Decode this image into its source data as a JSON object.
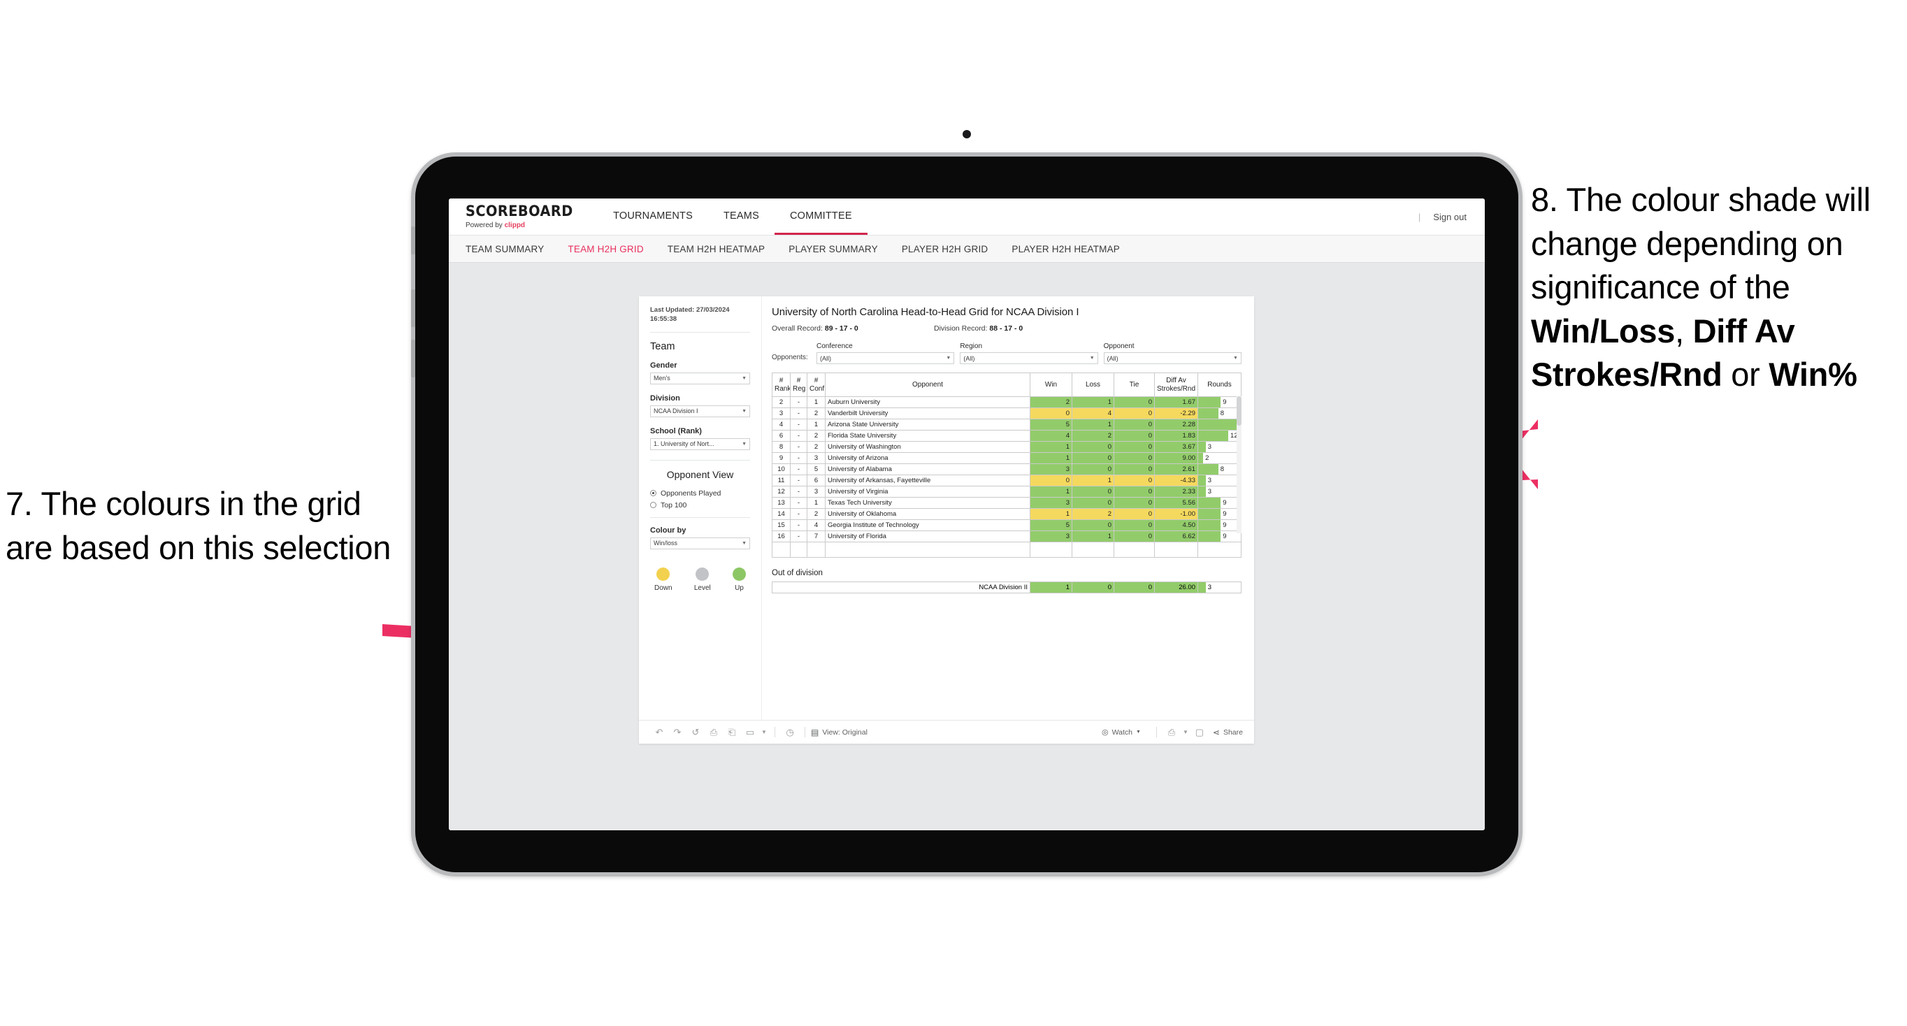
{
  "annotations": {
    "left": {
      "number": "7.",
      "text": "The colours in the grid are based on this selection"
    },
    "right": {
      "number": "8.",
      "line1": "The colour shade will change depending on significance of the ",
      "bold1": "Win/Loss",
      "mid1": ", ",
      "bold2": "Diff Av Strokes/Rnd",
      "mid2": " or ",
      "bold3": "Win%"
    },
    "arrow_color": "#ec2f63"
  },
  "app": {
    "brand": {
      "title": "SCOREBOARD",
      "powered_prefix": "Powered by ",
      "powered_name": "clippd"
    },
    "top_nav": [
      {
        "label": "TOURNAMENTS",
        "active": false
      },
      {
        "label": "TEAMS",
        "active": false
      },
      {
        "label": "COMMITTEE",
        "active": true
      }
    ],
    "sign_out": "Sign out",
    "sub_nav": [
      {
        "label": "TEAM SUMMARY",
        "active": false
      },
      {
        "label": "TEAM H2H GRID",
        "active": true
      },
      {
        "label": "TEAM H2H HEATMAP",
        "active": false
      },
      {
        "label": "PLAYER SUMMARY",
        "active": false
      },
      {
        "label": "PLAYER H2H GRID",
        "active": false
      },
      {
        "label": "PLAYER H2H HEATMAP",
        "active": false
      }
    ],
    "accent": "#e8315c"
  },
  "sidebar": {
    "last_updated": "Last Updated: 27/03/2024 16:55:38",
    "team_heading": "Team",
    "gender": {
      "label": "Gender",
      "value": "Men's"
    },
    "division": {
      "label": "Division",
      "value": "NCAA Division I"
    },
    "school": {
      "label": "School (Rank)",
      "value": "1. University of Nort..."
    },
    "opponent_view": {
      "heading": "Opponent View",
      "options": [
        {
          "label": "Opponents Played",
          "selected": true
        },
        {
          "label": "Top 100",
          "selected": false
        }
      ]
    },
    "colour_by": {
      "label": "Colour by",
      "value": "Win/loss"
    },
    "legend": [
      {
        "label": "Down",
        "color": "#f2d14e"
      },
      {
        "label": "Level",
        "color": "#c1c3c7"
      },
      {
        "label": "Up",
        "color": "#8dc765"
      }
    ]
  },
  "main": {
    "title": "University of North Carolina Head-to-Head Grid for NCAA Division I",
    "overall_record_label": "Overall Record: ",
    "overall_record_value": "89 - 17 - 0",
    "division_record_label": "Division Record: ",
    "division_record_value": "88 - 17 - 0",
    "opponents_label": "Opponents:",
    "filters": [
      {
        "label": "Conference",
        "value": "(All)"
      },
      {
        "label": "Region",
        "value": "(All)"
      },
      {
        "label": "Opponent",
        "value": "(All)"
      }
    ],
    "out_of_division_title": "Out of division"
  },
  "chart_data": {
    "type": "table",
    "title": "University of North Carolina Head-to-Head Grid for NCAA Division I",
    "columns": [
      "# Rank",
      "# Reg",
      "# Conf",
      "Opponent",
      "Win",
      "Loss",
      "Tie",
      "Diff Av Strokes/Rnd",
      "Rounds"
    ],
    "colors": {
      "up": "#92cc6a",
      "down": "#f5d95e",
      "level": "#c1c3c7",
      "rounds_bar": "#92cc6a"
    },
    "rounds_max": 17,
    "rows": [
      {
        "rank": "2",
        "reg": "-",
        "conf": "1",
        "opponent": "Auburn University",
        "win": "2",
        "loss": "1",
        "tie": "0",
        "diff": "1.67",
        "rounds": "9",
        "state": "up"
      },
      {
        "rank": "3",
        "reg": "-",
        "conf": "2",
        "opponent": "Vanderbilt University",
        "win": "0",
        "loss": "4",
        "tie": "0",
        "diff": "-2.29",
        "rounds": "8",
        "state": "down"
      },
      {
        "rank": "4",
        "reg": "-",
        "conf": "1",
        "opponent": "Arizona State University",
        "win": "5",
        "loss": "1",
        "tie": "0",
        "diff": "2.28",
        "rounds": "17",
        "state": "up"
      },
      {
        "rank": "6",
        "reg": "-",
        "conf": "2",
        "opponent": "Florida State University",
        "win": "4",
        "loss": "2",
        "tie": "0",
        "diff": "1.83",
        "rounds": "12",
        "state": "up"
      },
      {
        "rank": "8",
        "reg": "-",
        "conf": "2",
        "opponent": "University of Washington",
        "win": "1",
        "loss": "0",
        "tie": "0",
        "diff": "3.67",
        "rounds": "3",
        "state": "up"
      },
      {
        "rank": "9",
        "reg": "-",
        "conf": "3",
        "opponent": "University of Arizona",
        "win": "1",
        "loss": "0",
        "tie": "0",
        "diff": "9.00",
        "rounds": "2",
        "state": "up"
      },
      {
        "rank": "10",
        "reg": "-",
        "conf": "5",
        "opponent": "University of Alabama",
        "win": "3",
        "loss": "0",
        "tie": "0",
        "diff": "2.61",
        "rounds": "8",
        "state": "up"
      },
      {
        "rank": "11",
        "reg": "-",
        "conf": "6",
        "opponent": "University of Arkansas, Fayetteville",
        "win": "0",
        "loss": "1",
        "tie": "0",
        "diff": "-4.33",
        "rounds": "3",
        "state": "down"
      },
      {
        "rank": "12",
        "reg": "-",
        "conf": "3",
        "opponent": "University of Virginia",
        "win": "1",
        "loss": "0",
        "tie": "0",
        "diff": "2.33",
        "rounds": "3",
        "state": "up"
      },
      {
        "rank": "13",
        "reg": "-",
        "conf": "1",
        "opponent": "Texas Tech University",
        "win": "3",
        "loss": "0",
        "tie": "0",
        "diff": "5.56",
        "rounds": "9",
        "state": "up"
      },
      {
        "rank": "14",
        "reg": "-",
        "conf": "2",
        "opponent": "University of Oklahoma",
        "win": "1",
        "loss": "2",
        "tie": "0",
        "diff": "-1.00",
        "rounds": "9",
        "state": "down"
      },
      {
        "rank": "15",
        "reg": "-",
        "conf": "4",
        "opponent": "Georgia Institute of Technology",
        "win": "5",
        "loss": "0",
        "tie": "0",
        "diff": "4.50",
        "rounds": "9",
        "state": "up"
      },
      {
        "rank": "16",
        "reg": "-",
        "conf": "7",
        "opponent": "University of Florida",
        "win": "3",
        "loss": "1",
        "tie": "0",
        "diff": "6.62",
        "rounds": "9",
        "state": "up"
      }
    ],
    "out_of_division": [
      {
        "opponent": "NCAA Division II",
        "win": "1",
        "loss": "0",
        "tie": "0",
        "diff": "26.00",
        "rounds": "3",
        "state": "up"
      }
    ]
  },
  "toolbar": {
    "view_label": "View: Original",
    "watch_label": "Watch",
    "share_label": "Share"
  }
}
